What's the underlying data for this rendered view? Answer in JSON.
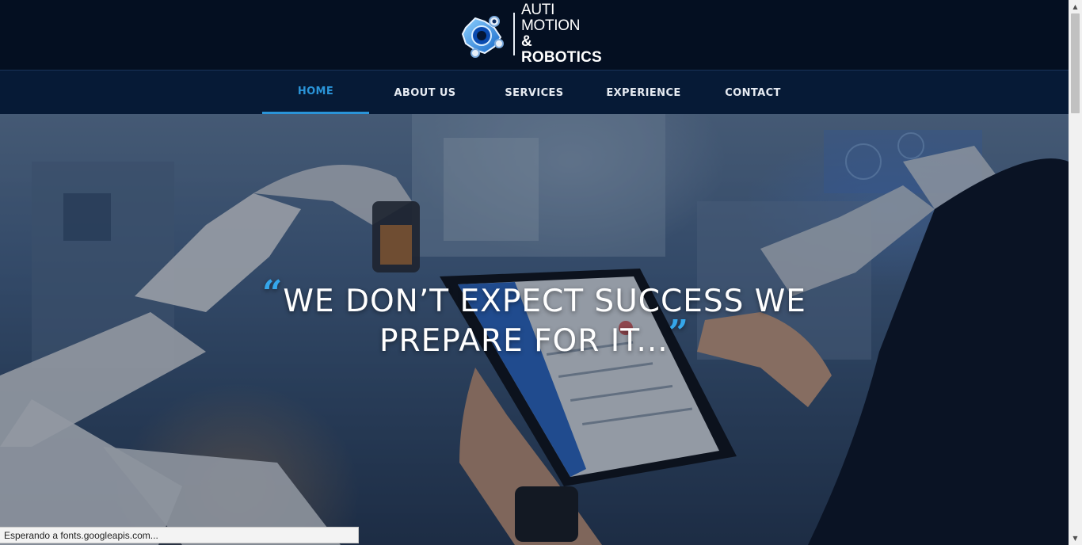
{
  "logo": {
    "line1": "AUTI MOTION",
    "line2": "& ROBOTICS",
    "icon": "robot-joint-icon"
  },
  "nav": {
    "items": [
      {
        "label": "HOME",
        "active": true
      },
      {
        "label": "ABOUT US",
        "active": false
      },
      {
        "label": "SERVICES",
        "active": false
      },
      {
        "label": "EXPERIENCE",
        "active": false
      },
      {
        "label": "CONTACT",
        "active": false
      }
    ]
  },
  "hero": {
    "open_quote": "“",
    "line1": "WE DON’T EXPECT SUCCESS WE",
    "line2": "PREPARE FOR IT...",
    "close_quote": "”",
    "background": "industrial-robot-arms-tablet-image"
  },
  "status_bar": {
    "text": "Esperando a fonts.googleapis.com..."
  },
  "colors": {
    "header_bg": "#040f21",
    "nav_bg": "#061a36",
    "accent": "#2a94d8",
    "text": "#ffffff"
  }
}
